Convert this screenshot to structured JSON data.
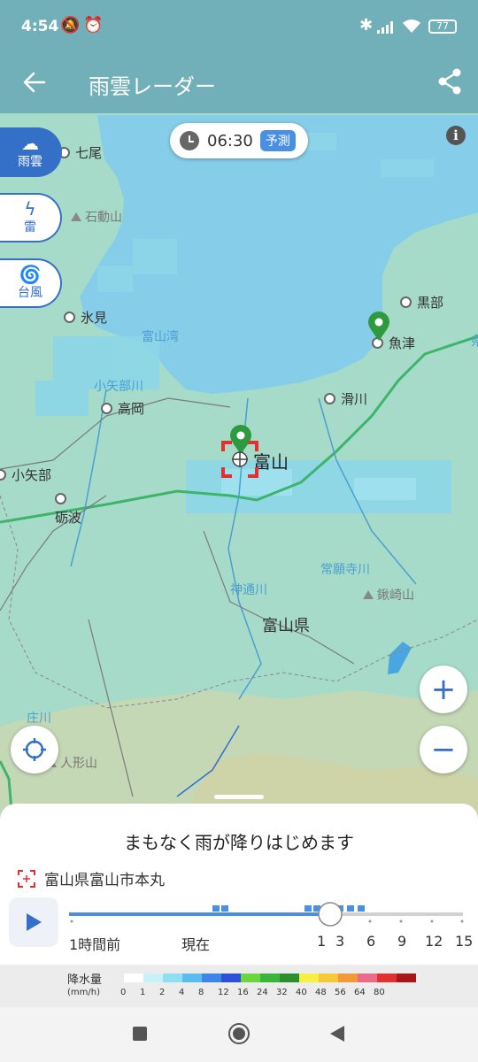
{
  "status": {
    "time": "4:54",
    "battery": "77"
  },
  "app": {
    "title": "雨雲レーダー"
  },
  "time_chip": {
    "time": "06:30",
    "badge": "予測"
  },
  "side_buttons": [
    {
      "label": "雨雲"
    },
    {
      "label": "雷"
    },
    {
      "label": "台風"
    }
  ],
  "map": {
    "places": [
      "七尾",
      "氷見",
      "高岡",
      "小矢部",
      "砺波",
      "黒部",
      "魚津",
      "滑川",
      "富山"
    ],
    "rivers": [
      "富山湾",
      "小矢部川",
      "常願寺川",
      "神通川",
      "庄川"
    ],
    "mountains": [
      "石動山",
      "鍬崎山",
      "人形山"
    ],
    "prefecture": "富山県",
    "edge_char": "県"
  },
  "sheet": {
    "headline": "まもなく雨が降りはじめます",
    "location": "富山県富山市本丸",
    "timeline_labels": [
      "1時間前",
      "現在",
      "1",
      "3",
      "6",
      "9",
      "12",
      "15"
    ]
  },
  "legend": {
    "title": "降水量",
    "unit": "(mm/h)",
    "values": [
      "0",
      "1",
      "2",
      "4",
      "8",
      "12",
      "16",
      "24",
      "32",
      "40",
      "48",
      "56",
      "64",
      "80"
    ],
    "colors": [
      "#ffffff",
      "#c8f2f7",
      "#8ee0f0",
      "#5bbcee",
      "#3b86e6",
      "#2f4fd6",
      "#6ad640",
      "#3cb53b",
      "#2b8f2b",
      "#f5ef46",
      "#f5c93a",
      "#f29a3a",
      "#ea6a8a",
      "#e0302f",
      "#a8161a"
    ]
  }
}
